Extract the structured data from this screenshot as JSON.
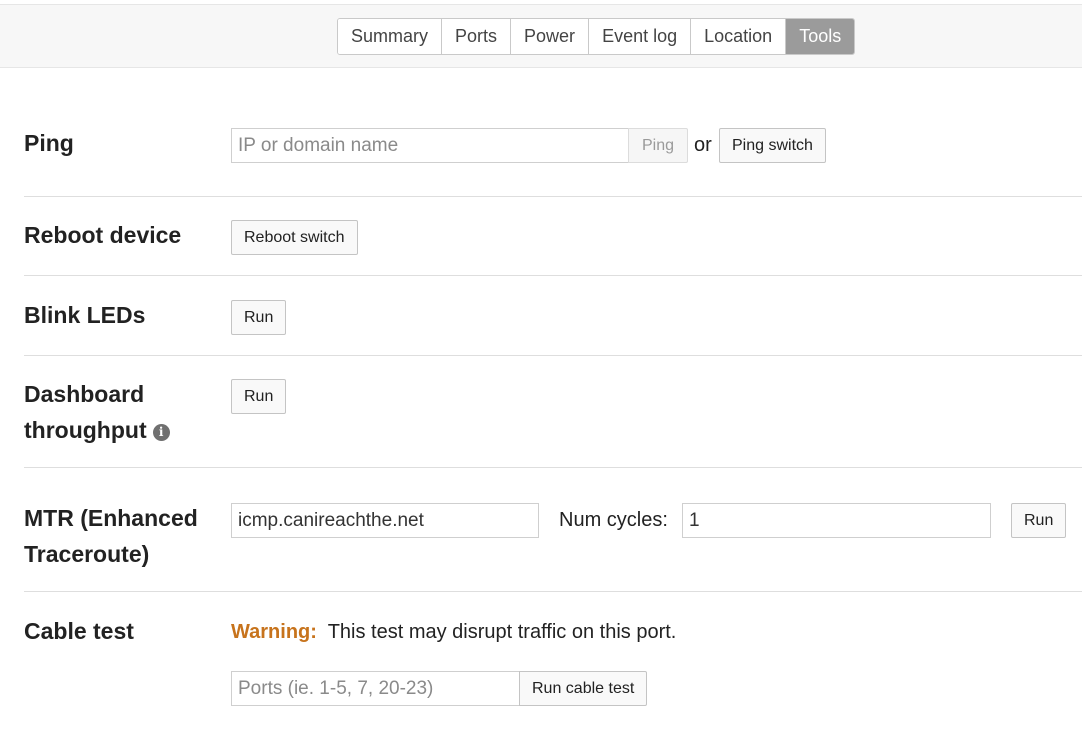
{
  "tabs": [
    {
      "label": "Summary",
      "active": false
    },
    {
      "label": "Ports",
      "active": false
    },
    {
      "label": "Power",
      "active": false
    },
    {
      "label": "Event log",
      "active": false
    },
    {
      "label": "Location",
      "active": false
    },
    {
      "label": "Tools",
      "active": true
    }
  ],
  "ping": {
    "label": "Ping",
    "placeholder": "IP or domain name",
    "ping_button": "Ping",
    "or_text": "or",
    "ping_switch_button": "Ping switch"
  },
  "reboot": {
    "label": "Reboot device",
    "button": "Reboot switch"
  },
  "blink": {
    "label": "Blink LEDs",
    "button": "Run"
  },
  "dashboard": {
    "label_line1": "Dashboard",
    "label_line2": "throughput",
    "info_icon": "info-icon",
    "button": "Run"
  },
  "mtr": {
    "label_line1": "MTR (Enhanced",
    "label_line2": "Traceroute)",
    "host_value": "icmp.canireachthe.net",
    "cycles_label": "Num cycles:",
    "cycles_value": "1",
    "button": "Run"
  },
  "cable": {
    "label": "Cable test",
    "warning_label": "Warning:",
    "warning_text": "This test may disrupt traffic on this port.",
    "placeholder": "Ports (ie. 1-5, 7, 20-23)",
    "button": "Run cable test"
  },
  "colors": {
    "active_tab": "#9b9b9b",
    "warning": "#c7731c"
  }
}
